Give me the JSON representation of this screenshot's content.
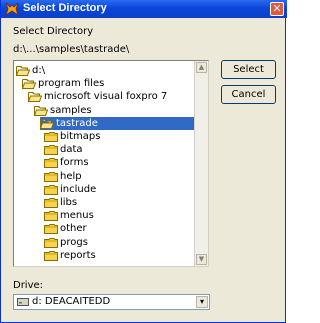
{
  "window": {
    "title": "Select Directory",
    "title_icon": "foxpro-icon",
    "close_label": "✕"
  },
  "prompt_label": "Select Directory",
  "current_path": "d:\\...\\samples\\tastrade\\",
  "tree": {
    "nodes": [
      {
        "label": "d:\\",
        "icon": "open-folder-icon",
        "open": true
      },
      {
        "label": "program files",
        "icon": "open-folder-icon",
        "open": true
      },
      {
        "label": "microsoft visual foxpro 7",
        "icon": "open-folder-icon",
        "open": true
      },
      {
        "label": "samples",
        "icon": "open-folder-icon",
        "open": true
      },
      {
        "label": "tastrade",
        "icon": "open-folder-icon",
        "open": true,
        "selected": true
      },
      {
        "label": "bitmaps",
        "icon": "folder-icon",
        "open": false
      },
      {
        "label": "data",
        "icon": "folder-icon",
        "open": false
      },
      {
        "label": "forms",
        "icon": "folder-icon",
        "open": false
      },
      {
        "label": "help",
        "icon": "folder-icon",
        "open": false
      },
      {
        "label": "include",
        "icon": "folder-icon",
        "open": false
      },
      {
        "label": "libs",
        "icon": "folder-icon",
        "open": false
      },
      {
        "label": "menus",
        "icon": "folder-icon",
        "open": false
      },
      {
        "label": "other",
        "icon": "folder-icon",
        "open": false
      },
      {
        "label": "progs",
        "icon": "folder-icon",
        "open": false
      },
      {
        "label": "reports",
        "icon": "folder-icon",
        "open": false
      }
    ]
  },
  "buttons": {
    "select_label": "Select",
    "cancel_label": "Cancel"
  },
  "drive": {
    "label": "Drive:",
    "value": "d: DEACAITEDD",
    "drop_glyph": "▾"
  },
  "colors": {
    "titlebar": "#0a46d8",
    "selection": "#316ac5",
    "folder": "#f5d34c"
  }
}
